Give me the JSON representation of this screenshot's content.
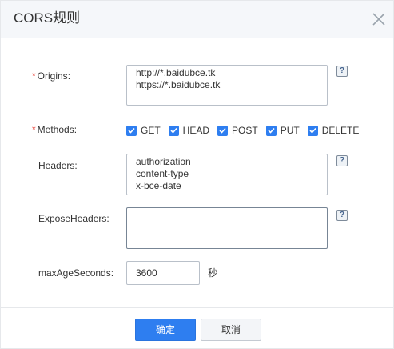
{
  "dialog": {
    "title": "CORS规则",
    "close_icon": "close-icon"
  },
  "origins": {
    "label": "Origins",
    "required_mark": "*",
    "colon": ":",
    "lines": [
      "http://*.baidubce.tk",
      "https://*.baidubce.tk"
    ],
    "help": "?"
  },
  "methods": {
    "label": "Methods",
    "required_mark": "*",
    "colon": ":",
    "options": [
      {
        "label": "GET",
        "checked": true
      },
      {
        "label": "HEAD",
        "checked": true
      },
      {
        "label": "POST",
        "checked": true
      },
      {
        "label": "PUT",
        "checked": true
      },
      {
        "label": "DELETE",
        "checked": true
      }
    ]
  },
  "headers": {
    "label": "Headers",
    "colon": ":",
    "lines": [
      "authorization",
      "content-type",
      "x-bce-date"
    ],
    "help": "?"
  },
  "expose_headers": {
    "label": "ExposeHeaders",
    "colon": ":",
    "value": "",
    "help": "?"
  },
  "max_age": {
    "label": "maxAgeSeconds",
    "colon": ":",
    "value": "3600",
    "unit": "秒"
  },
  "footer": {
    "confirm_label": "确定",
    "cancel_label": "取消"
  },
  "colors": {
    "primary": "#2e7ef0",
    "required": "#e8453c",
    "header_bg": "#f5f7fa"
  }
}
